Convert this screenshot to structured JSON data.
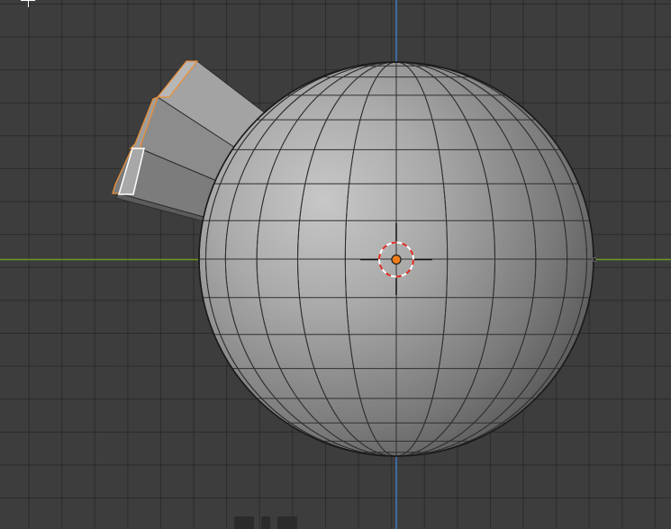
{
  "viewport": {
    "mode": "edit",
    "background_color": "#3d3d3d",
    "grid_color": "#2a2a2a",
    "x_axis_color": "#6f9a25",
    "z_axis_color": "#3f78c4"
  },
  "scene": {
    "objects": [
      {
        "name": "sphere",
        "type": "uv-sphere",
        "segments": 24,
        "rings": 16,
        "shading": "solid-gray"
      },
      {
        "name": "extruded-face",
        "type": "extrusion",
        "selected_color": "#e8903a",
        "active_face_color": "#ffffff"
      }
    ],
    "origin_color": "#f07d1c",
    "cursor_3d_colors": [
      "#e0291f",
      "#ffffff"
    ]
  },
  "bottom_toolbar": {
    "buttons": [
      "tool-a",
      "tool-b",
      "tool-c"
    ]
  }
}
